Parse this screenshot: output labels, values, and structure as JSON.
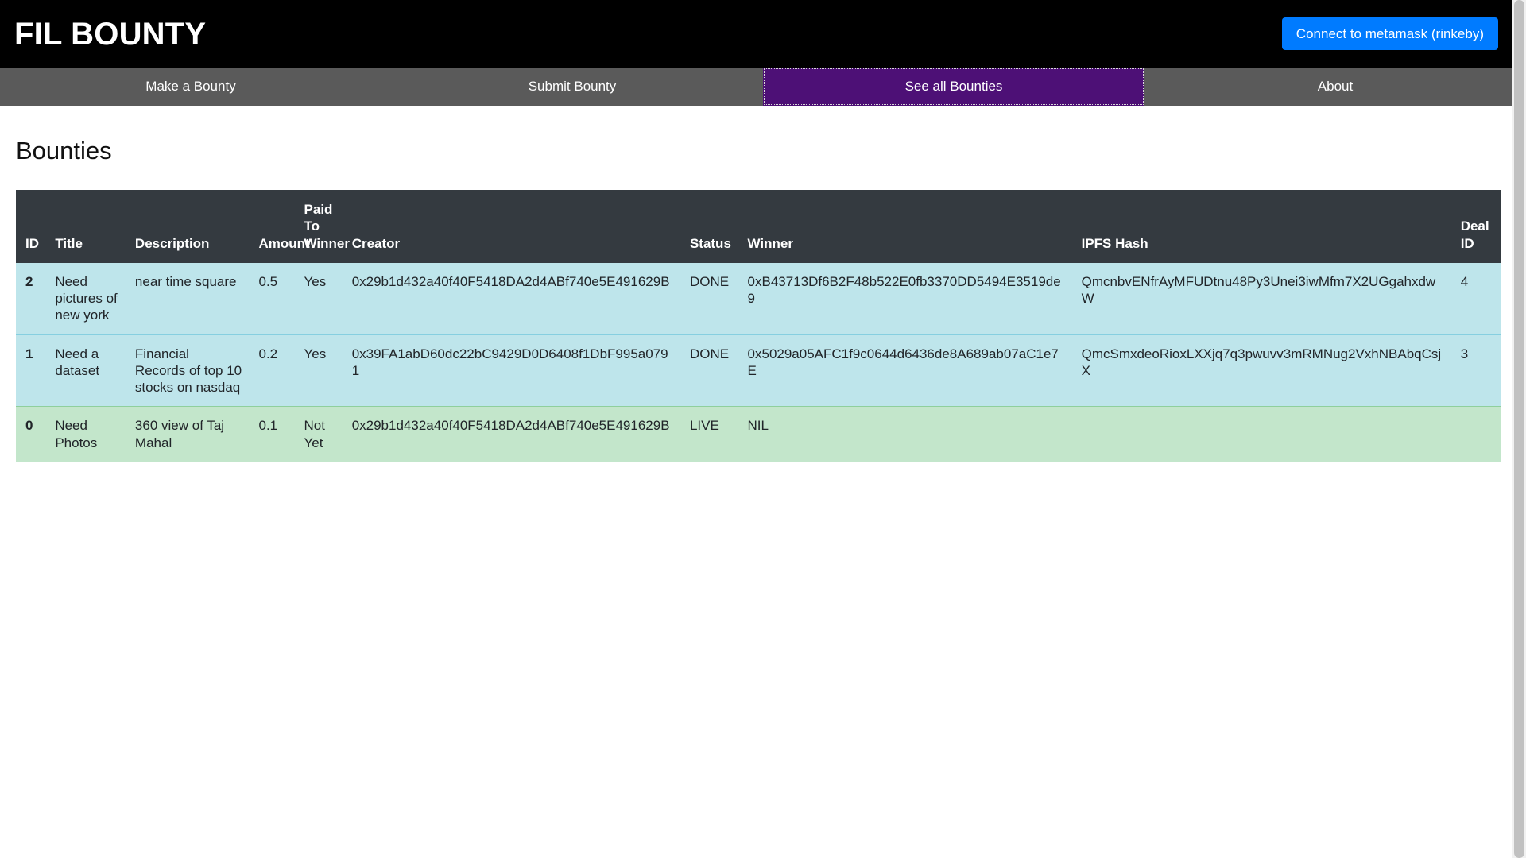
{
  "header": {
    "brand": "FIL BOUNTY",
    "connect_button": "Connect to metamask (rinkeby)",
    "accent_blue": "#007bff",
    "background": "#000000"
  },
  "nav": {
    "active_color": "#4d1076",
    "bar_color": "#5a5a5a",
    "items": [
      {
        "label": "Make a Bounty",
        "active": false
      },
      {
        "label": "Submit Bounty",
        "active": false
      },
      {
        "label": "See all Bounties",
        "active": true
      },
      {
        "label": "About",
        "active": false
      }
    ]
  },
  "main": {
    "title": "Bounties",
    "table": {
      "header_background": "#343a40",
      "row_done_color": "#bee5eb",
      "row_live_color": "#c3e6cb",
      "columns": [
        "ID",
        "Title",
        "Description",
        "Amount",
        "Paid To Winner",
        "Creator",
        "Status",
        "Winner",
        "IPFS Hash",
        "Deal ID"
      ],
      "rows": [
        {
          "id": "2",
          "title": "Need pictures of new york",
          "description": "near time square",
          "amount": "0.5",
          "paid_to_winner": "Yes",
          "creator": "0x29b1d432a40f40F5418DA2d4ABf740e5E491629B",
          "status": "DONE",
          "winner": "0xB43713Df6B2F48b522E0fb3370DD5494E3519de9",
          "ipfs_hash": "QmcnbvENfrAyMFUDtnu48Py3Unei3iwMfm7X2UGgahxdwW",
          "deal_id": "4"
        },
        {
          "id": "1",
          "title": "Need a dataset",
          "description": "Financial Records of top 10 stocks on nasdaq",
          "amount": "0.2",
          "paid_to_winner": "Yes",
          "creator": "0x39FA1abD60dc22bC9429D0D6408f1DbF995a0791",
          "status": "DONE",
          "winner": "0x5029a05AFC1f9c0644d6436de8A689ab07aC1e7E",
          "ipfs_hash": "QmcSmxdeoRioxLXXjq7q3pwuvv3mRMNug2VxhNBAbqCsjX",
          "deal_id": "3"
        },
        {
          "id": "0",
          "title": "Need Photos",
          "description": "360 view of Taj Mahal",
          "amount": "0.1",
          "paid_to_winner": "Not Yet",
          "creator": "0x29b1d432a40f40F5418DA2d4ABf740e5E491629B",
          "status": "LIVE",
          "winner": "NIL",
          "ipfs_hash": "",
          "deal_id": ""
        }
      ]
    }
  }
}
